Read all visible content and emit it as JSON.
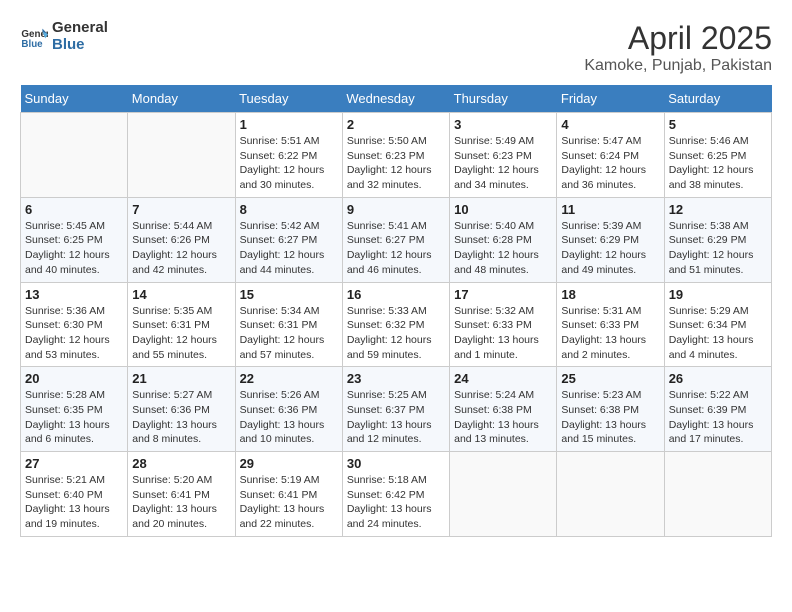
{
  "logo": {
    "line1": "General",
    "line2": "Blue"
  },
  "title": "April 2025",
  "subtitle": "Kamoke, Punjab, Pakistan",
  "days_of_week": [
    "Sunday",
    "Monday",
    "Tuesday",
    "Wednesday",
    "Thursday",
    "Friday",
    "Saturday"
  ],
  "weeks": [
    [
      {
        "day": null
      },
      {
        "day": null
      },
      {
        "day": 1,
        "sunrise": "5:51 AM",
        "sunset": "6:22 PM",
        "daylight": "12 hours and 30 minutes."
      },
      {
        "day": 2,
        "sunrise": "5:50 AM",
        "sunset": "6:23 PM",
        "daylight": "12 hours and 32 minutes."
      },
      {
        "day": 3,
        "sunrise": "5:49 AM",
        "sunset": "6:23 PM",
        "daylight": "12 hours and 34 minutes."
      },
      {
        "day": 4,
        "sunrise": "5:47 AM",
        "sunset": "6:24 PM",
        "daylight": "12 hours and 36 minutes."
      },
      {
        "day": 5,
        "sunrise": "5:46 AM",
        "sunset": "6:25 PM",
        "daylight": "12 hours and 38 minutes."
      }
    ],
    [
      {
        "day": 6,
        "sunrise": "5:45 AM",
        "sunset": "6:25 PM",
        "daylight": "12 hours and 40 minutes."
      },
      {
        "day": 7,
        "sunrise": "5:44 AM",
        "sunset": "6:26 PM",
        "daylight": "12 hours and 42 minutes."
      },
      {
        "day": 8,
        "sunrise": "5:42 AM",
        "sunset": "6:27 PM",
        "daylight": "12 hours and 44 minutes."
      },
      {
        "day": 9,
        "sunrise": "5:41 AM",
        "sunset": "6:27 PM",
        "daylight": "12 hours and 46 minutes."
      },
      {
        "day": 10,
        "sunrise": "5:40 AM",
        "sunset": "6:28 PM",
        "daylight": "12 hours and 48 minutes."
      },
      {
        "day": 11,
        "sunrise": "5:39 AM",
        "sunset": "6:29 PM",
        "daylight": "12 hours and 49 minutes."
      },
      {
        "day": 12,
        "sunrise": "5:38 AM",
        "sunset": "6:29 PM",
        "daylight": "12 hours and 51 minutes."
      }
    ],
    [
      {
        "day": 13,
        "sunrise": "5:36 AM",
        "sunset": "6:30 PM",
        "daylight": "12 hours and 53 minutes."
      },
      {
        "day": 14,
        "sunrise": "5:35 AM",
        "sunset": "6:31 PM",
        "daylight": "12 hours and 55 minutes."
      },
      {
        "day": 15,
        "sunrise": "5:34 AM",
        "sunset": "6:31 PM",
        "daylight": "12 hours and 57 minutes."
      },
      {
        "day": 16,
        "sunrise": "5:33 AM",
        "sunset": "6:32 PM",
        "daylight": "12 hours and 59 minutes."
      },
      {
        "day": 17,
        "sunrise": "5:32 AM",
        "sunset": "6:33 PM",
        "daylight": "13 hours and 1 minute."
      },
      {
        "day": 18,
        "sunrise": "5:31 AM",
        "sunset": "6:33 PM",
        "daylight": "13 hours and 2 minutes."
      },
      {
        "day": 19,
        "sunrise": "5:29 AM",
        "sunset": "6:34 PM",
        "daylight": "13 hours and 4 minutes."
      }
    ],
    [
      {
        "day": 20,
        "sunrise": "5:28 AM",
        "sunset": "6:35 PM",
        "daylight": "13 hours and 6 minutes."
      },
      {
        "day": 21,
        "sunrise": "5:27 AM",
        "sunset": "6:36 PM",
        "daylight": "13 hours and 8 minutes."
      },
      {
        "day": 22,
        "sunrise": "5:26 AM",
        "sunset": "6:36 PM",
        "daylight": "13 hours and 10 minutes."
      },
      {
        "day": 23,
        "sunrise": "5:25 AM",
        "sunset": "6:37 PM",
        "daylight": "13 hours and 12 minutes."
      },
      {
        "day": 24,
        "sunrise": "5:24 AM",
        "sunset": "6:38 PM",
        "daylight": "13 hours and 13 minutes."
      },
      {
        "day": 25,
        "sunrise": "5:23 AM",
        "sunset": "6:38 PM",
        "daylight": "13 hours and 15 minutes."
      },
      {
        "day": 26,
        "sunrise": "5:22 AM",
        "sunset": "6:39 PM",
        "daylight": "13 hours and 17 minutes."
      }
    ],
    [
      {
        "day": 27,
        "sunrise": "5:21 AM",
        "sunset": "6:40 PM",
        "daylight": "13 hours and 19 minutes."
      },
      {
        "day": 28,
        "sunrise": "5:20 AM",
        "sunset": "6:41 PM",
        "daylight": "13 hours and 20 minutes."
      },
      {
        "day": 29,
        "sunrise": "5:19 AM",
        "sunset": "6:41 PM",
        "daylight": "13 hours and 22 minutes."
      },
      {
        "day": 30,
        "sunrise": "5:18 AM",
        "sunset": "6:42 PM",
        "daylight": "13 hours and 24 minutes."
      },
      {
        "day": null
      },
      {
        "day": null
      },
      {
        "day": null
      }
    ]
  ]
}
